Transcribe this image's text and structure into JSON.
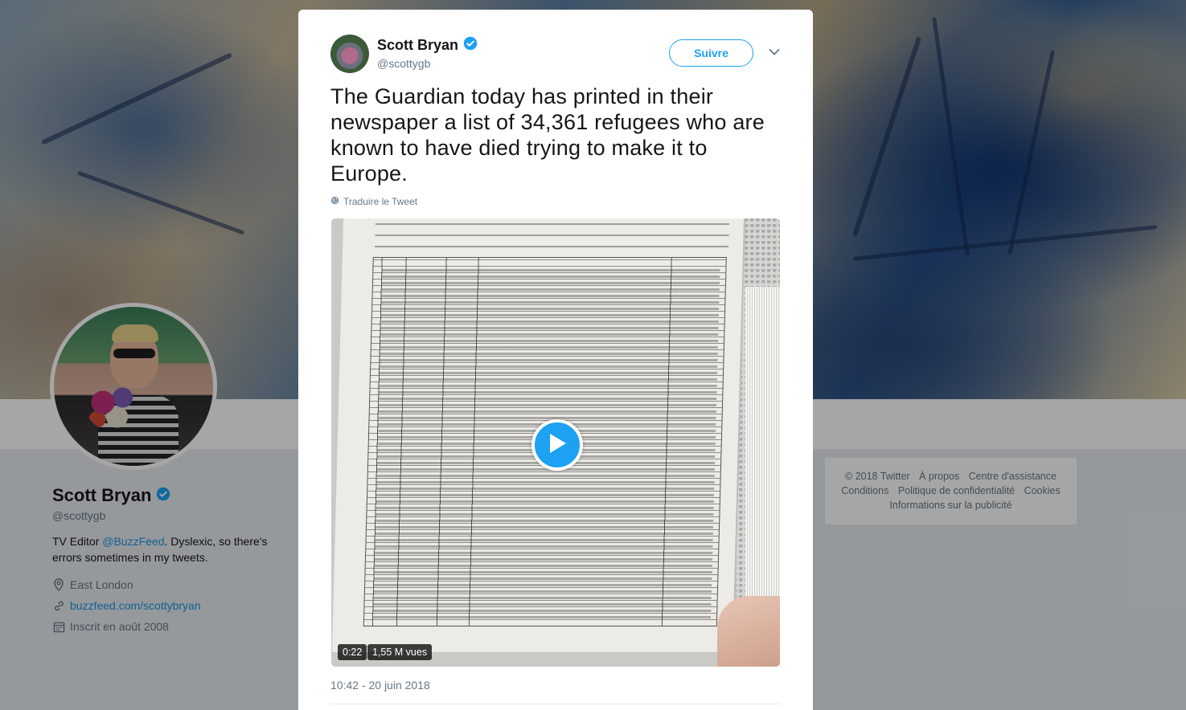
{
  "profile": {
    "name": "Scott Bryan",
    "handle": "@scottygb",
    "bio_prefix": "TV Editor ",
    "bio_mention": "@BuzzFeed",
    "bio_suffix": ". Dyslexic, so there's errors sometimes in my tweets.",
    "location": "East London",
    "website": "buzzfeed.com/scottybryan",
    "joined": "Inscrit en août 2008"
  },
  "footer": {
    "links": [
      "© 2018 Twitter",
      "À propos",
      "Centre d'assistance",
      "Conditions",
      "Politique de confidentialité",
      "Cookies",
      "Informations sur la publicité"
    ]
  },
  "tweet": {
    "author_name": "Scott Bryan",
    "author_handle": "@scottygb",
    "follow_label": "Suivre",
    "text": "The Guardian today has printed in their newspaper a list of 34,361 refugees who are known to have died trying to make it to Europe.",
    "translate_label": "Traduire le Tweet",
    "video_duration": "0:22",
    "video_views": "1,55 M vues",
    "timestamp": "10:42 - 20 juin 2018"
  },
  "icons": {
    "verified": "verified-badge-icon",
    "caret": "chevron-down-icon",
    "globe": "globe-icon",
    "play": "play-icon",
    "location": "location-pin-icon",
    "link": "link-icon",
    "calendar": "calendar-icon"
  },
  "colors": {
    "accent": "#1da1f2",
    "link": "#1b95e0",
    "muted": "#657786",
    "text": "#14171a"
  }
}
